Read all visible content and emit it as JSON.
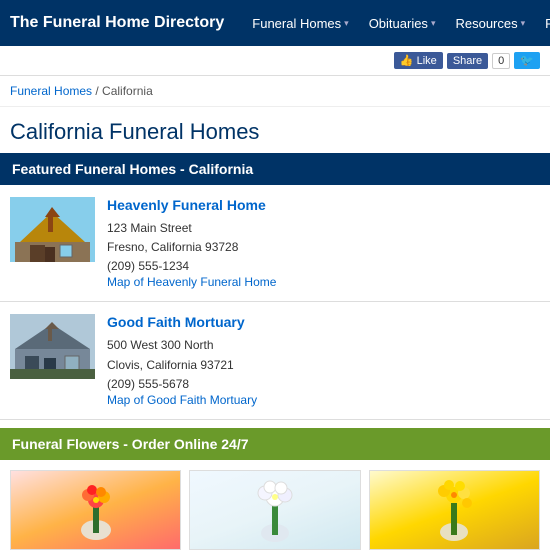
{
  "site": {
    "title": "The Funeral Home Directory"
  },
  "nav": {
    "items": [
      {
        "label": "Funeral Homes",
        "has_arrow": true
      },
      {
        "label": "Obituaries",
        "has_arrow": true
      },
      {
        "label": "Resources",
        "has_arrow": true
      },
      {
        "label": "Foll",
        "has_arrow": false
      }
    ]
  },
  "social": {
    "like_label": "Like",
    "share_label": "Share",
    "share_count": "0"
  },
  "breadcrumb": {
    "home_label": "Funeral Homes",
    "separator": "/",
    "current": "California"
  },
  "page_title": "California Funeral Homes",
  "featured": {
    "header": "Featured Funeral Homes - California",
    "listings": [
      {
        "name": "Heavenly Funeral Home",
        "address_line1": "123 Main Street",
        "address_line2": "Fresno, California 93728",
        "phone": "(209) 555-1234",
        "map_label": "Map of Heavenly Funeral Home",
        "img_alt": "Heavenly Funeral Home"
      },
      {
        "name": "Good Faith Mortuary",
        "address_line1": "500 West 300 North",
        "address_line2": "Clovis, California 93721",
        "phone": "(209) 555-5678",
        "map_label": "Map of Good Faith Mortuary",
        "img_alt": "Good Faith Mortuary"
      }
    ]
  },
  "flowers": {
    "header": "Funeral Flowers - Order Online 24/7",
    "items": [
      {
        "alt": "Red and orange flower arrangement"
      },
      {
        "alt": "White flower arrangement"
      },
      {
        "alt": "Yellow flower arrangement"
      }
    ]
  }
}
